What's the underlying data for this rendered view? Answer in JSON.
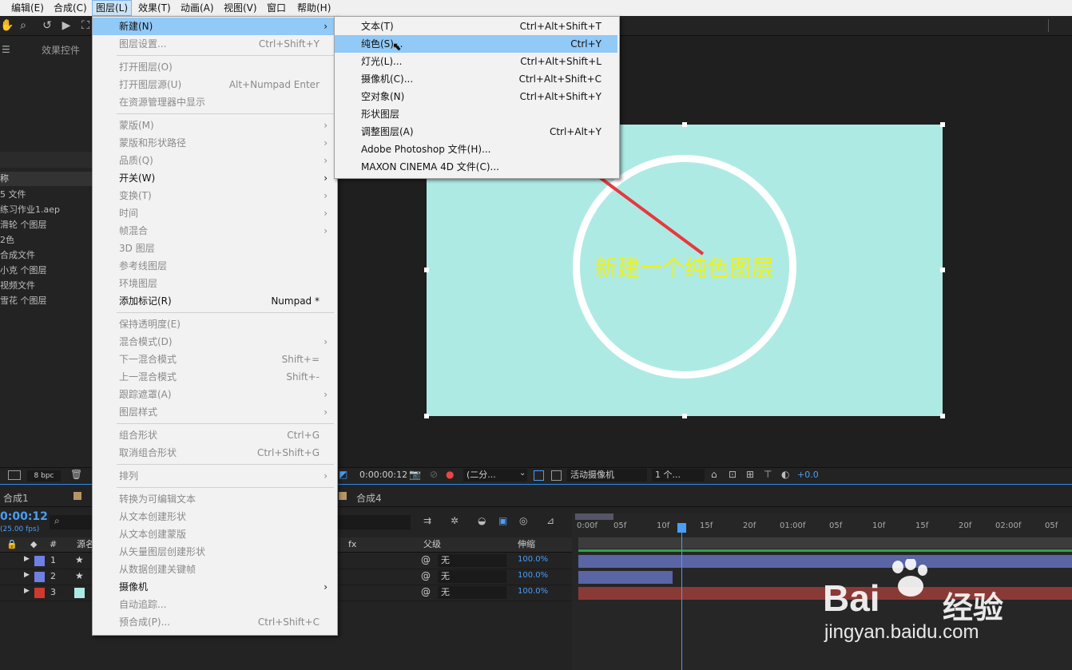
{
  "menubar": {
    "items": [
      "编辑(E)",
      "合成(C)",
      "图层(L)",
      "效果(T)",
      "动画(A)",
      "视图(V)",
      "窗口",
      "帮助(H)"
    ],
    "active": "图层(L)"
  },
  "left_panel": {
    "tab": "效果控件",
    "header": "称",
    "rows": [
      "5 文件",
      "练习作业1.aep",
      "滑轮 个图层",
      "2色",
      "合成文件",
      "小克 个图层",
      "视频文件",
      "雪花 个图层"
    ]
  },
  "layer_menu": {
    "items": [
      {
        "label": "新建(N)",
        "shortcut": "",
        "submenu": true,
        "disabled": false,
        "highlighted": true
      },
      {
        "label": "图层设置...",
        "shortcut": "Ctrl+Shift+Y",
        "submenu": false,
        "disabled": true
      },
      {
        "sep": true
      },
      {
        "label": "打开图层(O)",
        "shortcut": "",
        "submenu": false,
        "disabled": true
      },
      {
        "label": "打开图层源(U)",
        "shortcut": "Alt+Numpad Enter",
        "submenu": false,
        "disabled": true
      },
      {
        "label": "在资源管理器中显示",
        "shortcut": "",
        "submenu": false,
        "disabled": true
      },
      {
        "sep": true
      },
      {
        "label": "蒙版(M)",
        "shortcut": "",
        "submenu": true,
        "disabled": true
      },
      {
        "label": "蒙版和形状路径",
        "shortcut": "",
        "submenu": true,
        "disabled": true
      },
      {
        "label": "品质(Q)",
        "shortcut": "",
        "submenu": true,
        "disabled": true
      },
      {
        "label": "开关(W)",
        "shortcut": "",
        "submenu": true,
        "disabled": false
      },
      {
        "label": "变换(T)",
        "shortcut": "",
        "submenu": true,
        "disabled": true
      },
      {
        "label": "时间",
        "shortcut": "",
        "submenu": true,
        "disabled": true
      },
      {
        "label": "帧混合",
        "shortcut": "",
        "submenu": true,
        "disabled": true
      },
      {
        "label": "3D 图层",
        "shortcut": "",
        "submenu": false,
        "disabled": true
      },
      {
        "label": "参考线图层",
        "shortcut": "",
        "submenu": false,
        "disabled": true
      },
      {
        "label": "环境图层",
        "shortcut": "",
        "submenu": false,
        "disabled": true
      },
      {
        "label": "添加标记(R)",
        "shortcut": "Numpad *",
        "submenu": false,
        "disabled": false
      },
      {
        "sep": true
      },
      {
        "label": "保持透明度(E)",
        "shortcut": "",
        "submenu": false,
        "disabled": true
      },
      {
        "label": "混合模式(D)",
        "shortcut": "",
        "submenu": true,
        "disabled": true
      },
      {
        "label": "下一混合模式",
        "shortcut": "Shift+=",
        "submenu": false,
        "disabled": true
      },
      {
        "label": "上一混合模式",
        "shortcut": "Shift+-",
        "submenu": false,
        "disabled": true
      },
      {
        "label": "跟踪遮罩(A)",
        "shortcut": "",
        "submenu": true,
        "disabled": true
      },
      {
        "label": "图层样式",
        "shortcut": "",
        "submenu": true,
        "disabled": true
      },
      {
        "sep": true
      },
      {
        "label": "组合形状",
        "shortcut": "Ctrl+G",
        "submenu": false,
        "disabled": true
      },
      {
        "label": "取消组合形状",
        "shortcut": "Ctrl+Shift+G",
        "submenu": false,
        "disabled": true
      },
      {
        "sep": true
      },
      {
        "label": "排列",
        "shortcut": "",
        "submenu": true,
        "disabled": true
      },
      {
        "sep": true
      },
      {
        "label": "转换为可编辑文本",
        "shortcut": "",
        "submenu": false,
        "disabled": true
      },
      {
        "label": "从文本创建形状",
        "shortcut": "",
        "submenu": false,
        "disabled": true
      },
      {
        "label": "从文本创建蒙版",
        "shortcut": "",
        "submenu": false,
        "disabled": true
      },
      {
        "label": "从矢量图层创建形状",
        "shortcut": "",
        "submenu": false,
        "disabled": true
      },
      {
        "label": "从数据创建关键帧",
        "shortcut": "",
        "submenu": false,
        "disabled": true
      },
      {
        "label": "摄像机",
        "shortcut": "",
        "submenu": true,
        "disabled": false
      },
      {
        "label": "自动追踪...",
        "shortcut": "",
        "submenu": false,
        "disabled": true
      },
      {
        "label": "预合成(P)...",
        "shortcut": "Ctrl+Shift+C",
        "submenu": false,
        "disabled": true
      }
    ]
  },
  "new_submenu": {
    "items": [
      {
        "label": "文本(T)",
        "shortcut": "Ctrl+Alt+Shift+T",
        "highlighted": false
      },
      {
        "label": "纯色(S)...",
        "shortcut": "Ctrl+Y",
        "highlighted": true
      },
      {
        "label": "灯光(L)...",
        "shortcut": "Ctrl+Alt+Shift+L",
        "highlighted": false
      },
      {
        "label": "摄像机(C)...",
        "shortcut": "Ctrl+Alt+Shift+C",
        "highlighted": false
      },
      {
        "label": "空对象(N)",
        "shortcut": "Ctrl+Alt+Shift+Y",
        "highlighted": false
      },
      {
        "label": "形状图层",
        "shortcut": "",
        "highlighted": false
      },
      {
        "label": "调整图层(A)",
        "shortcut": "Ctrl+Alt+Y",
        "highlighted": false
      },
      {
        "label": "Adobe Photoshop 文件(H)...",
        "shortcut": "",
        "highlighted": false
      },
      {
        "label": "MAXON CINEMA 4D 文件(C)...",
        "shortcut": "",
        "highlighted": false
      }
    ]
  },
  "viewer": {
    "caption": "新建一个纯色图层",
    "canvas_color": "#aeeae4",
    "caption_color": "#f1f10e"
  },
  "viewer_bar": {
    "bpc": "8 bpc",
    "timecode": "0:00:00:12",
    "resolution": "(二分...",
    "camera": "活动摄像机",
    "views": "1 个...",
    "exposure": "+0.0"
  },
  "timeline": {
    "tab1": "合成1",
    "tab4": "合成4",
    "timecode": "0:00:12",
    "fps": "(25.00 fps)",
    "col_num": "#",
    "col_source": "源名",
    "col_parent": "父级",
    "col_stretch": "伸缩",
    "ruler": [
      "0:00f",
      "05f",
      "10f",
      "15f",
      "20f",
      "01:00f",
      "05f",
      "10f",
      "15f",
      "20f",
      "02:00f",
      "05f"
    ],
    "layers": [
      {
        "num": "1",
        "color": "#6f7fe3",
        "parent": "无",
        "stretch": "100.0%"
      },
      {
        "num": "2",
        "color": "#6f7fe3",
        "parent": "无",
        "stretch": "100.0%"
      },
      {
        "num": "3",
        "color": "#d03a2e",
        "parent": "无",
        "stretch": "100.0%"
      }
    ]
  },
  "watermark": {
    "brand": "Bai",
    "brand_cn": "经验",
    "url": "jingyan.baidu.com"
  }
}
